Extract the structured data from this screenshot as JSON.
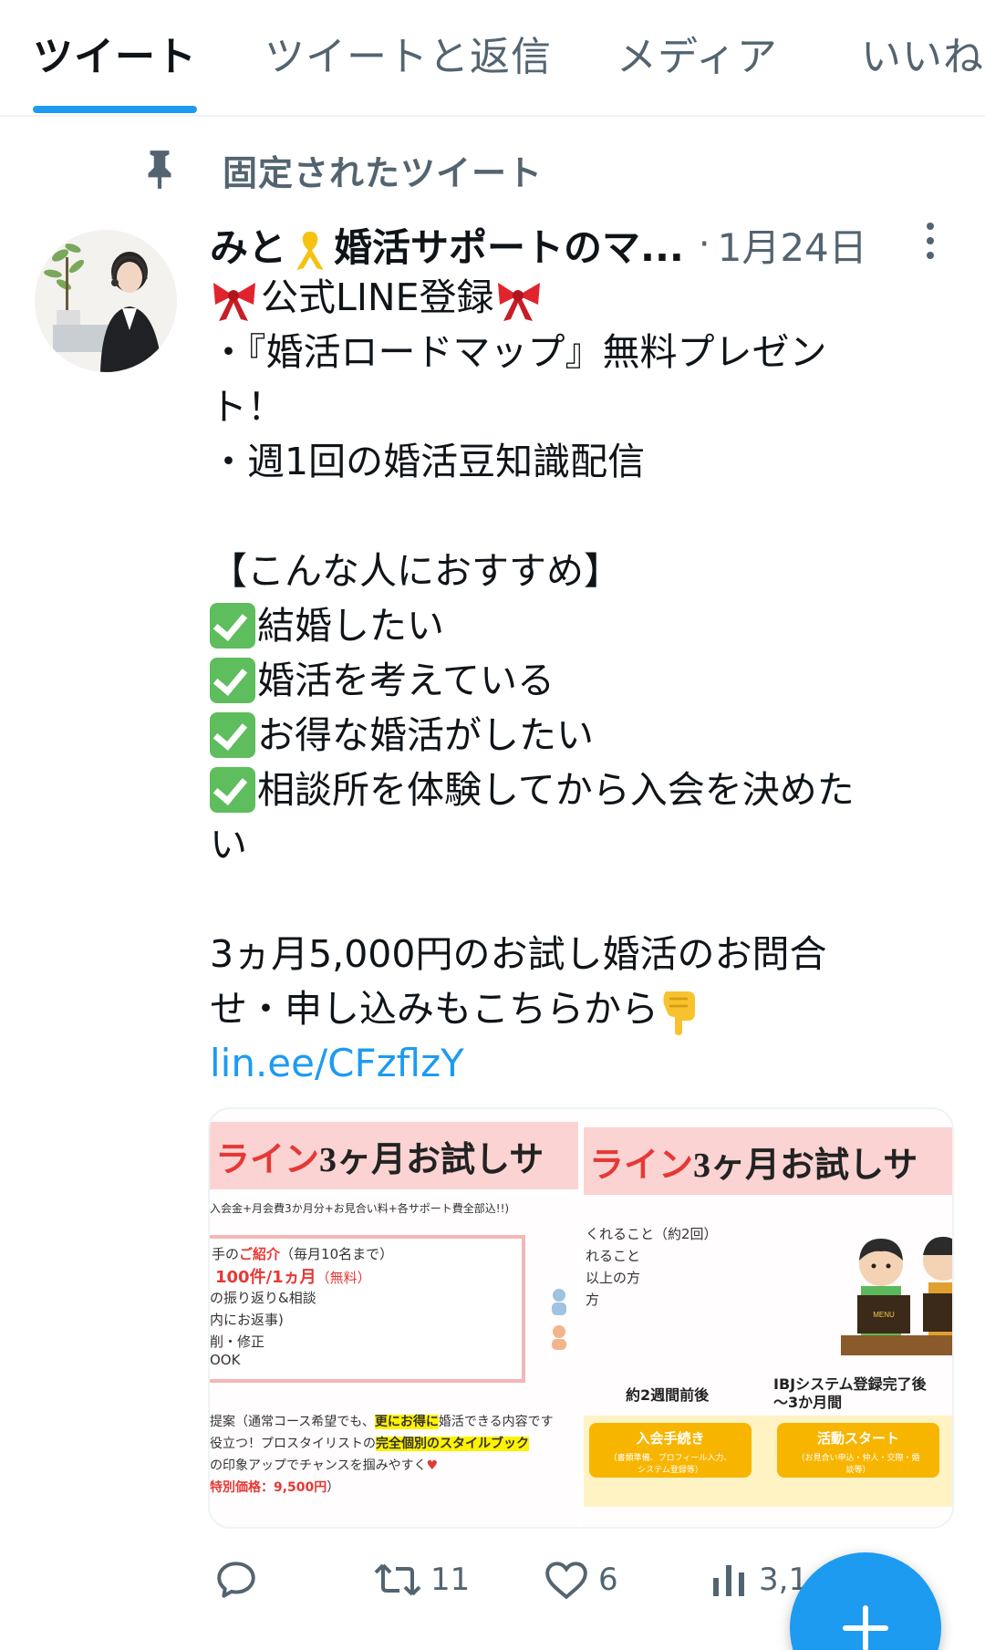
{
  "tabs": [
    {
      "label": "ツイート",
      "active": true
    },
    {
      "label": "ツイートと返信",
      "active": false
    },
    {
      "label": "メディア",
      "active": false
    },
    {
      "label": "いいね",
      "active": false
    }
  ],
  "pinned": {
    "label": "固定されたツイート",
    "icon": "pin-icon"
  },
  "tweet": {
    "display_name_prefix": "みと",
    "display_name_suffix": "婚活サポートのマ...",
    "separator": "·",
    "date": "1月24日",
    "lines": {
      "l1": "公式LINE登録",
      "l2": "・『婚活ロードマップ』無料プレゼン",
      "l3": "ト！",
      "l4": "・週1回の婚活豆知識配信",
      "l5": "【こんな人におすすめ】",
      "l6": "結婚したい",
      "l7": "婚活を考えている",
      "l8": "お得な婚活がしたい",
      "l9": "相談所を体験してから入会を決めた",
      "l10": "い",
      "l11": "3ヵ月5,000円のお試し婚活のお問合",
      "l12": "せ・申し込みもこちらから"
    },
    "link": "lin.ee/CFzflzY"
  },
  "media": {
    "left": {
      "banner_red": "ライン",
      "banner_black": "3ヶ月お試しサ",
      "note": "入会金+月会費3か月分+お見合い料+各サポート費全部込!!)",
      "t1a": "手の",
      "t1b": "ご紹介",
      "t1c": "（毎月10名まで）",
      "t2a": "100件/1ヵ月",
      "t2b": "（無料）",
      "t3": "の振り返り&相談",
      "t4": "内にお返事)",
      "t5": "削・修正",
      "t6": "OOK",
      "p1a": "提案（通常コース希望でも、",
      "p1b": "更にお得に",
      "p1c": "婚活できる内容です",
      "p2a": "役立つ！プロスタイリストの",
      "p2b": "完全個別のスタイルブック",
      "p3": "の印象アップでチャンスを掴みやすく",
      "p4": "特別価格：9,500円",
      "p4b": "）"
    },
    "right": {
      "banner_red": "ライン",
      "banner_black": "3ヶ月お試しサ",
      "r1": "くれること（約2回）",
      "r2": "れること",
      "r3": "以上の方",
      "r4": "方",
      "before": "約2週間前後",
      "after1": "IBJシステム登録完了後",
      "after2": "〜3か月間",
      "step1": "入会手続き",
      "step1_sub1": "（書類準備、プロフィール入力、",
      "step1_sub2": "システム登録等）",
      "step2": "活動スタート",
      "step2_sub1": "（お見合い申込・仲人・交際・婚",
      "step2_sub2": "談等）",
      "book_label": "MENU"
    }
  },
  "actions": {
    "reply": {
      "icon": "reply-icon",
      "count": ""
    },
    "retweet": {
      "icon": "retweet-icon",
      "count": "11"
    },
    "like": {
      "icon": "heart-icon",
      "count": "6"
    },
    "views": {
      "icon": "views-icon",
      "count": "3,1"
    }
  },
  "fab": {
    "icon": "plus-icon"
  },
  "colors": {
    "accent": "#1d9bf0",
    "muted": "#536471",
    "text": "#0f1419"
  }
}
